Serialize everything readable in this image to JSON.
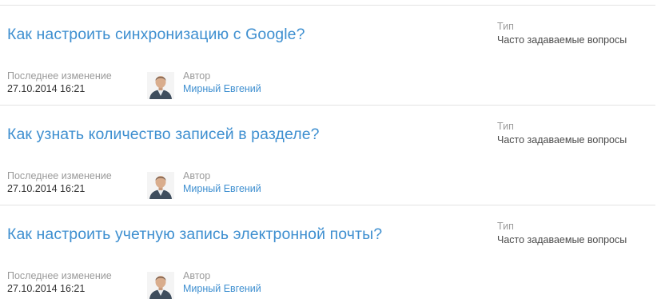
{
  "articles": [
    {
      "title": "Как настроить синхронизацию с Google?",
      "type_label": "Тип",
      "type_value": "Часто задаваемые вопросы",
      "modified_label": "Последнее изменение",
      "modified_value": "27.10.2014 16:21",
      "author_label": "Автор",
      "author_name": "Мирный Евгений"
    },
    {
      "title": "Как узнать количество записей в разделе?",
      "type_label": "Тип",
      "type_value": "Часто задаваемые вопросы",
      "modified_label": "Последнее изменение",
      "modified_value": "27.10.2014 16:21",
      "author_label": "Автор",
      "author_name": "Мирный Евгений"
    },
    {
      "title": "Как настроить учетную запись электронной почты?",
      "type_label": "Тип",
      "type_value": "Часто задаваемые вопросы",
      "modified_label": "Последнее изменение",
      "modified_value": "27.10.2014 16:21",
      "author_label": "Автор",
      "author_name": "Мирный Евгений"
    }
  ],
  "colors": {
    "link": "#3e8fd0",
    "label": "#9a9a9a",
    "value": "#333333",
    "divider": "#e3e3e3"
  },
  "icons": {
    "avatar": "user-photo-icon"
  }
}
